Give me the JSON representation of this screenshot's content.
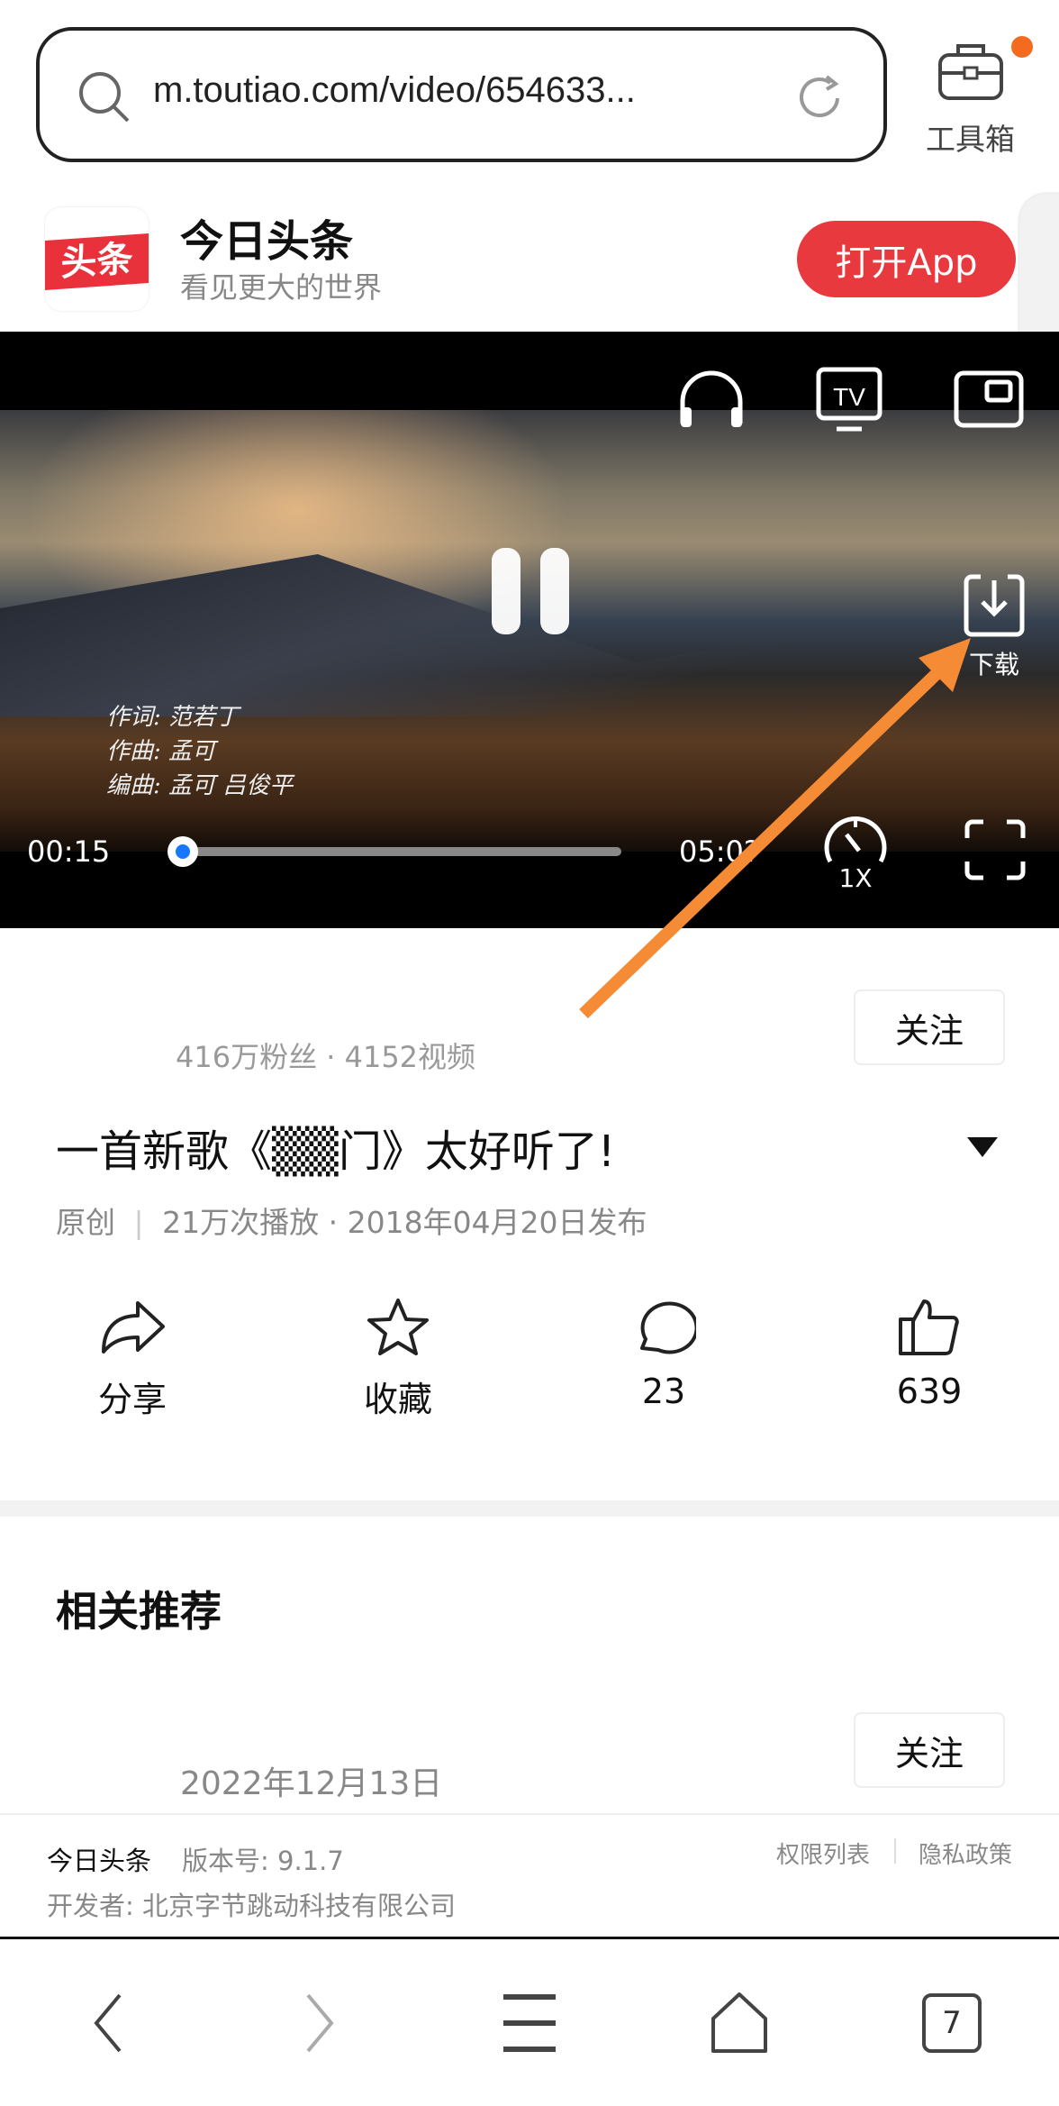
{
  "browser": {
    "url": "m.toutiao.com/video/654633...",
    "toolbox_label": "工具箱",
    "tab_count": "7",
    "accent": "#f46a1f"
  },
  "app_banner": {
    "logo_text": "头条",
    "title": "今日头条",
    "subtitle": "看见更大的世界",
    "open_button": "打开App",
    "brand_color": "#e8393f"
  },
  "video": {
    "credits": [
      "作词: 范若丁",
      "作曲: 孟可",
      "编曲: 孟可 吕俊平"
    ],
    "current_time": "00:15",
    "duration": "05:0?",
    "progress_fraction": 0.05,
    "speed": "1X",
    "download_label": "下载",
    "tv_label": "TV",
    "state": "playing"
  },
  "author": {
    "stats": "416万粉丝 · 4152视频",
    "follow_label": "关注"
  },
  "post": {
    "title": "一首新歌《▒▒门》太好听了!",
    "original": "原创",
    "meta": "21万次播放 · 2018年04月20日发布"
  },
  "actions": [
    {
      "icon": "share-icon",
      "label": "分享"
    },
    {
      "icon": "star-icon",
      "label": "收藏"
    },
    {
      "icon": "comment-icon",
      "label": "23"
    },
    {
      "icon": "thumbs-up-icon",
      "label": "639"
    }
  ],
  "related": {
    "heading": "相关推荐",
    "item_date": "2022年12月13日",
    "follow_label": "关注"
  },
  "footer": {
    "app_name": "今日头条",
    "version": "版本号: 9.1.7",
    "developer": "开发者: 北京字节跳动科技有限公司",
    "permissions": "权限列表",
    "privacy": "隐私政策"
  }
}
